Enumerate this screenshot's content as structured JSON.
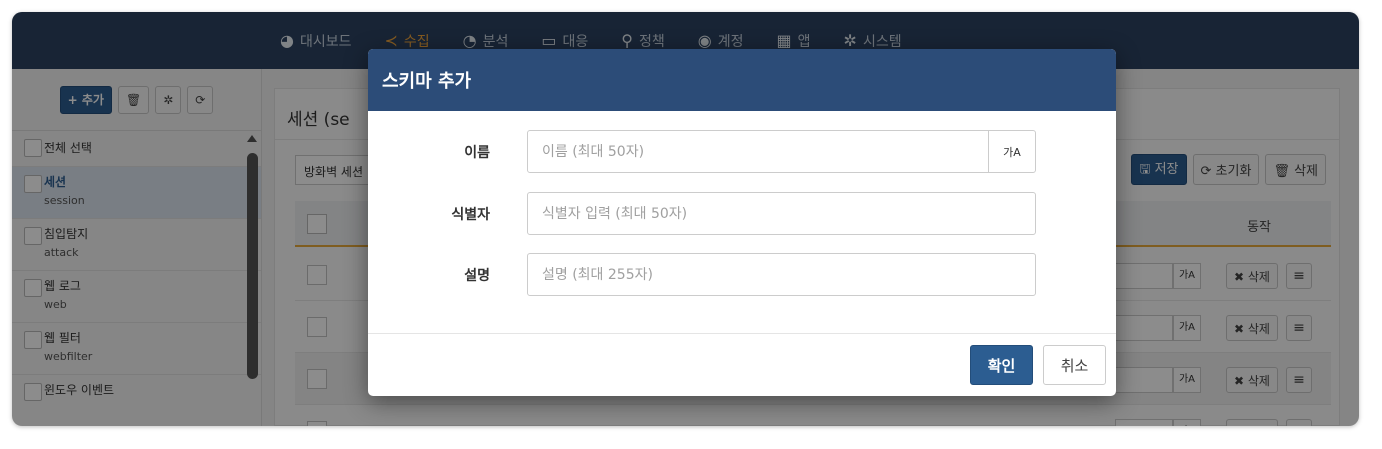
{
  "nav": {
    "items": [
      {
        "label": "대시보드",
        "icon": "dashboard-gauge-icon",
        "glyph": "◕"
      },
      {
        "label": "수집",
        "icon": "share-icon",
        "glyph": "≺"
      },
      {
        "label": "분석",
        "icon": "pie-chart-icon",
        "glyph": "◔"
      },
      {
        "label": "대응",
        "icon": "laptop-icon",
        "glyph": "▭"
      },
      {
        "label": "정책",
        "icon": "search-icon",
        "glyph": "⚲"
      },
      {
        "label": "계정",
        "icon": "user-circle-icon",
        "glyph": "◉"
      },
      {
        "label": "앱",
        "icon": "grid-icon",
        "glyph": "▦"
      },
      {
        "label": "시스템",
        "icon": "gear-icon",
        "glyph": "✲"
      }
    ],
    "active": "수집",
    "active_color": "#f0a43c"
  },
  "sidebar": {
    "add_label": "+ 추가",
    "trash_glyph": "🗑",
    "gear_glyph": "✲",
    "refresh_glyph": "⟳",
    "select_all": "전체 선택",
    "items": [
      {
        "name": "세션",
        "sub": "session"
      },
      {
        "name": "침입탐지",
        "sub": "attack"
      },
      {
        "name": "웹 로그",
        "sub": "web"
      },
      {
        "name": "웹 필터",
        "sub": "webfilter"
      },
      {
        "name": "윈도우 이벤트",
        "sub": ""
      }
    ]
  },
  "main": {
    "title": "세션 (se",
    "filter_value": "방화벽 세션",
    "save_label": "🖫 저장",
    "reset_label": "⟳ 초기화",
    "delete_label": "🗑 삭제",
    "col_action": "동작",
    "row_trans_label": "가A",
    "row_delete_label": "✖ 삭제",
    "row_menu_glyph": "≡"
  },
  "modal": {
    "title": "스키마 추가",
    "fields": {
      "name": {
        "label": "이름",
        "placeholder": "이름 (최대 50자)",
        "trans_label": "가A"
      },
      "identifier": {
        "label": "식별자",
        "placeholder": "식별자 입력 (최대 50자)"
      },
      "description": {
        "label": "설명",
        "placeholder": "설명 (최대 255자)"
      }
    },
    "ok_label": "확인",
    "cancel_label": "취소"
  }
}
